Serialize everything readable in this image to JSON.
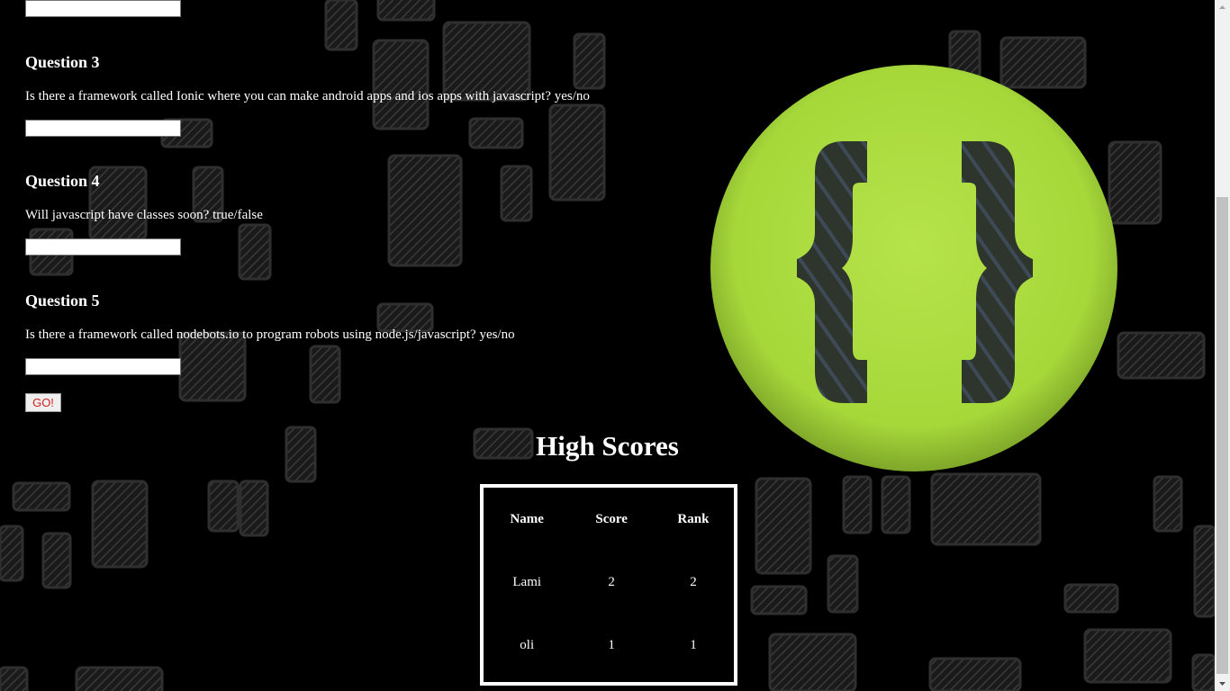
{
  "questions": [
    {
      "heading": "Question 3",
      "text": "Is there a framework called Ionic where you can make android apps and ios apps with javascript? yes/no",
      "value": ""
    },
    {
      "heading": "Question 4",
      "text": "Will javascript have classes soon? true/false",
      "value": ""
    },
    {
      "heading": "Question 5",
      "text": "Is there a framework called nodebots.io to program robots using node.js/javascript? yes/no",
      "value": ""
    }
  ],
  "previous_answer_value": "",
  "go_button_label": "GO!",
  "high_scores": {
    "title": "High Scores",
    "headers": {
      "name": "Name",
      "score": "Score",
      "rank": "Rank"
    },
    "rows": [
      {
        "name": "Lami",
        "score": "2",
        "rank": "2"
      },
      {
        "name": "oli",
        "score": "1",
        "rank": "1"
      }
    ]
  },
  "icons": {
    "logo": "curly-braces-logo-icon",
    "scroll_up": "chevron-up-icon",
    "scroll_down": "chevron-down-icon"
  },
  "colors": {
    "logo_green": "#a6d83a",
    "go_text": "#d02020",
    "background": "#000000"
  }
}
